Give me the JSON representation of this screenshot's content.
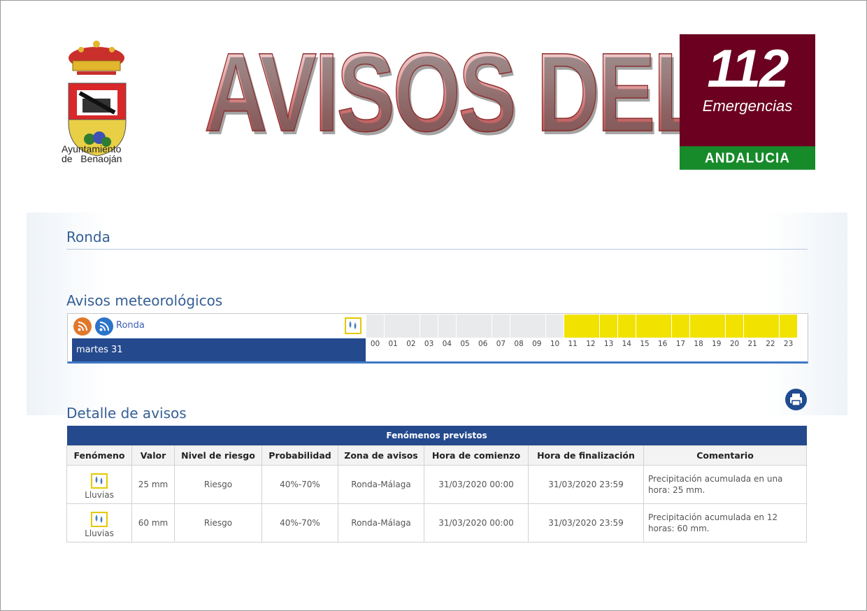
{
  "header": {
    "coat_text_line1": "Ayuntamiento",
    "coat_text_line2": "de   Benaoján",
    "big_title": "AVISOS DEL",
    "logo_number": "112",
    "logo_subtitle": "Emergencias",
    "logo_region": "ANDALUCIA"
  },
  "location_title": "Ronda",
  "timeline": {
    "section_title": "Avisos meteorológicos",
    "place": "Ronda",
    "day": "martes 31",
    "hours": [
      "00",
      "01",
      "02",
      "03",
      "04",
      "05",
      "06",
      "07",
      "08",
      "09",
      "10",
      "11",
      "12",
      "13",
      "14",
      "15",
      "16",
      "17",
      "18",
      "19",
      "20",
      "21",
      "22",
      "23"
    ],
    "active_from_hour": 11,
    "active_to_hour": 23,
    "active_color": "#f2e200",
    "icon": "rain-icon"
  },
  "detail": {
    "section_title": "Detalle de avisos",
    "table_title": "Fenómenos previstos",
    "columns": [
      "Fenómeno",
      "Valor",
      "Nivel de riesgo",
      "Probabilidad",
      "Zona de avisos",
      "Hora de comienzo",
      "Hora de finalización",
      "Comentario"
    ],
    "rows": [
      {
        "fenomeno": "Lluvias",
        "valor": "25 mm",
        "nivel": "Riesgo",
        "probabilidad": "40%-70%",
        "zona": "Ronda-Málaga",
        "comienzo": "31/03/2020 00:00",
        "fin": "31/03/2020 23:59",
        "comentario": "Precipitación acumulada en una hora: 25 mm."
      },
      {
        "fenomeno": "Lluvias",
        "valor": "60 mm",
        "nivel": "Riesgo",
        "probabilidad": "40%-70%",
        "zona": "Ronda-Málaga",
        "comienzo": "31/03/2020 00:00",
        "fin": "31/03/2020 23:59",
        "comentario": "Precipitación acumulada en 12 horas: 60 mm."
      }
    ]
  },
  "colors": {
    "accent_blue": "#24498d",
    "title_blue": "#355f95",
    "warning_yellow": "#f2e200",
    "brand_112": "#6b0020",
    "brand_green": "#178a2a"
  }
}
